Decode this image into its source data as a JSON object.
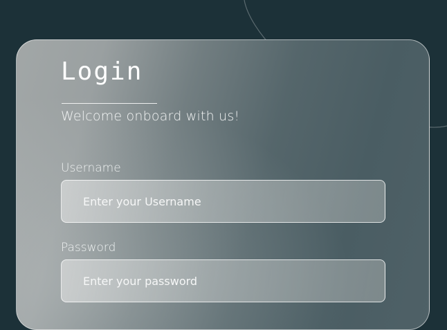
{
  "login_form": {
    "title": "Login",
    "subtitle": "Welcome onboard with us!",
    "username": {
      "label": "Username",
      "placeholder": "Enter your Username",
      "value": ""
    },
    "password": {
      "label": "Password",
      "placeholder": "Enter your password",
      "value": ""
    }
  },
  "colors": {
    "background": "#1c3138",
    "text": "#ffffff"
  }
}
